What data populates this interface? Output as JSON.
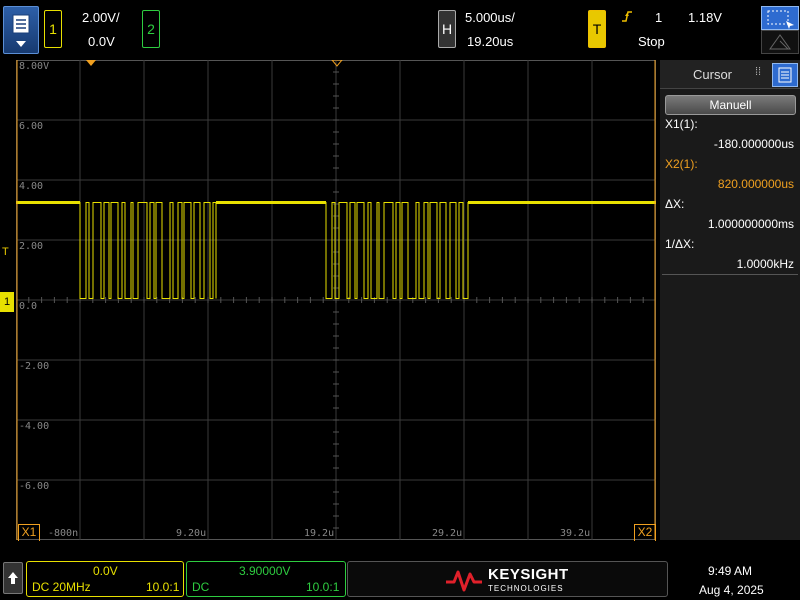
{
  "top": {
    "ch1_label": "1",
    "ch1_scale": "2.00V/",
    "ch1_offset": "0.0V",
    "ch2_label": "2",
    "horiz_label": "H",
    "horiz_scale": "5.000us/",
    "horiz_delay": "19.20us",
    "trig_label": "T",
    "trig_source": "1",
    "trig_level": "1.18V",
    "run_state": "Stop"
  },
  "graticule": {
    "y_labels": [
      "8.00V",
      "6.00",
      "4.00",
      "2.00",
      "0.0",
      "-2.00",
      "-4.00",
      "-6.00"
    ],
    "x_labels": [
      "-800n",
      "9.20u",
      "19.2u",
      "29.2u",
      "39.2u"
    ],
    "cursor_x1_label": "X1",
    "cursor_x2_label": "X2",
    "trigger_marker": "T",
    "ch1_ground_marker": "1"
  },
  "panel": {
    "title": "Cursor",
    "mode_button": "Manuell",
    "x1_label": "X1(1):",
    "x1_value": "-180.000000us",
    "x2_label": "X2(1):",
    "x2_value": "820.000000us",
    "dx_label": "ΔX:",
    "dx_value": "1.000000000ms",
    "inv_dx_label": "1/ΔX:",
    "inv_dx_value": "1.0000kHz"
  },
  "bottom": {
    "ch1_offset": "0.0V",
    "ch1_coupling": "DC 20MHz",
    "ch1_probe": "10.0:1",
    "ch2_offset": "3.90000V",
    "ch2_coupling": "DC",
    "ch2_probe": "10.0:1",
    "brand_name": "KEYSIGHT",
    "brand_sub": "TECHNOLOGIES",
    "time": "9:49 AM",
    "date": "Aug 4, 2025"
  },
  "colors": {
    "ch1": "#e8e000",
    "ch2": "#2ecc40",
    "cursor": "#f0a020",
    "trigger": "#f0c000",
    "accent": "#2e6bd0"
  }
}
